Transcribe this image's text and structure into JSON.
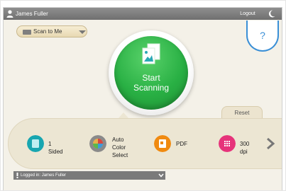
{
  "header": {
    "user_name": "James Fuller",
    "logout_label": "Logout"
  },
  "scan_destination": {
    "selected": "Scan to Me"
  },
  "help": {
    "label": "?"
  },
  "start_button": {
    "line1": "Start",
    "line2": "Scanning"
  },
  "reset": {
    "label": "Reset"
  },
  "settings": [
    {
      "icon": "sided-icon",
      "label": "1 Sided",
      "color": "#18a6b0"
    },
    {
      "icon": "color-mode-icon",
      "line1": "Auto Color",
      "line2": "Select",
      "color": "#8a8a8a"
    },
    {
      "icon": "file-format-icon",
      "label": "PDF",
      "color": "#f08a10"
    },
    {
      "icon": "resolution-icon",
      "label": "300 dpi",
      "color": "#e6337a"
    }
  ],
  "footer": {
    "logged_in_text": "Logged in: James Fuller"
  },
  "colors": {
    "accent_green": "#29b044",
    "help_blue": "#3a8fd6",
    "topbar_gray": "#7f7f7f"
  }
}
